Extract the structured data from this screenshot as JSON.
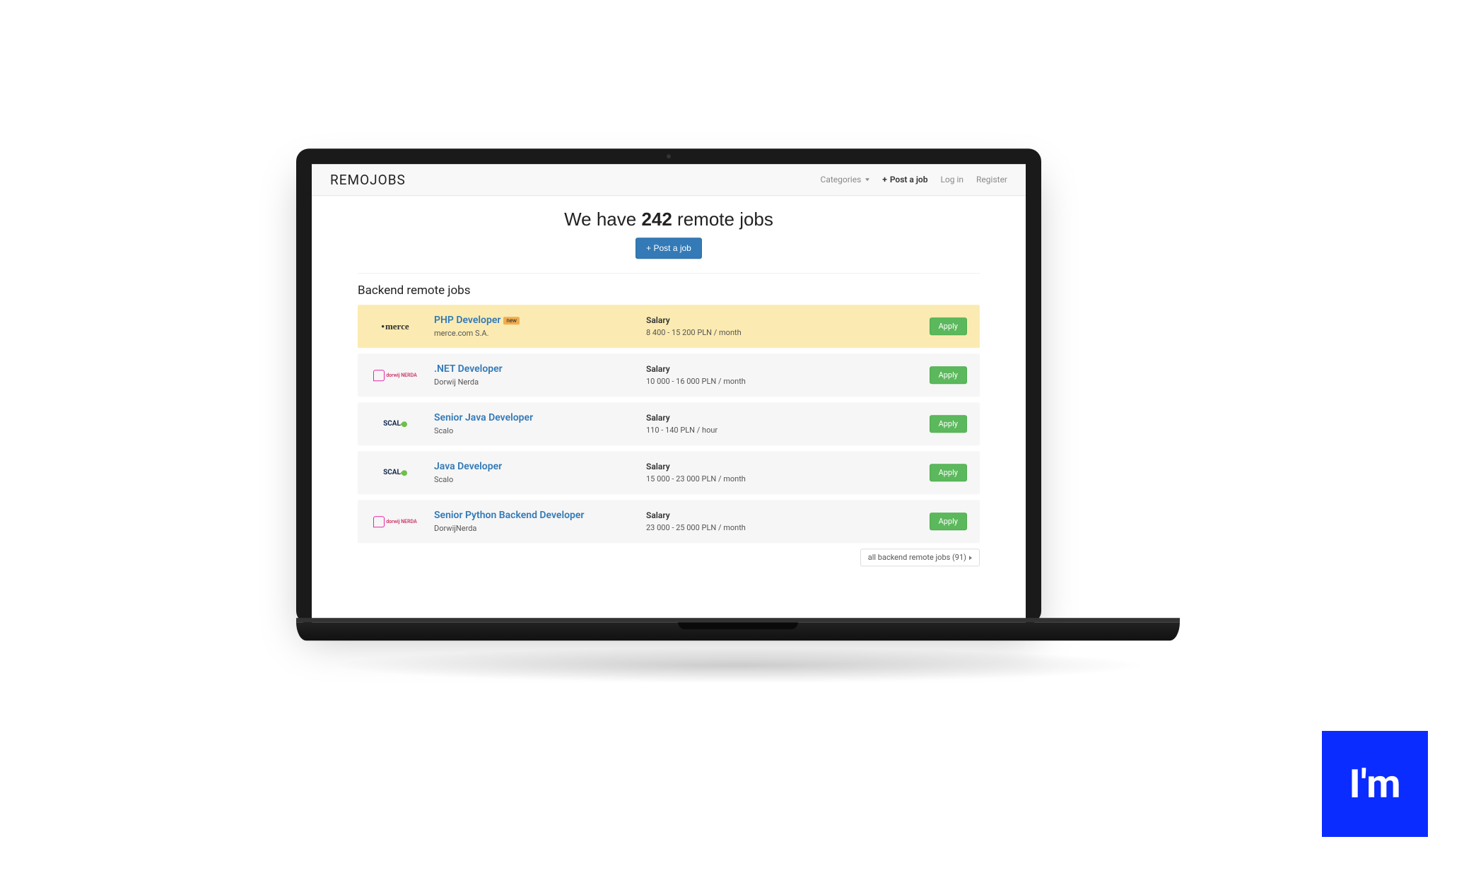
{
  "brand": "REMOJOBS",
  "nav": {
    "categories": "Categories",
    "post": "Post a job",
    "login": "Log in",
    "register": "Register"
  },
  "hero": {
    "prefix": "We have ",
    "count": "242",
    "suffix": " remote jobs",
    "cta": "+ Post a job"
  },
  "section_title": "Backend remote jobs",
  "salary_label": "Salary",
  "apply_label": "Apply",
  "jobs": [
    {
      "title": "PHP Developer",
      "company": "merce.com S.A.",
      "salary": "8 400 - 15 200 PLN / month",
      "new": "new",
      "logo": "merce",
      "featured": true
    },
    {
      "title": ".NET Developer",
      "company": "Dorwij Nerda",
      "salary": "10 000 - 16 000 PLN / month",
      "logo": "nerda"
    },
    {
      "title": "Senior Java Developer",
      "company": "Scalo",
      "salary": "110 - 140 PLN / hour",
      "logo": "scalo"
    },
    {
      "title": "Java Developer",
      "company": "Scalo",
      "salary": "15 000 - 23 000 PLN / month",
      "logo": "scalo"
    },
    {
      "title": "Senior Python Backend Developer",
      "company": "DorwijNerda",
      "salary": "23 000 - 25 000 PLN / month",
      "logo": "nerda"
    }
  ],
  "footer_link": {
    "text": "all backend remote jobs (91)"
  },
  "watermark": "I'm",
  "nerda_label": "dorwij NERDA"
}
